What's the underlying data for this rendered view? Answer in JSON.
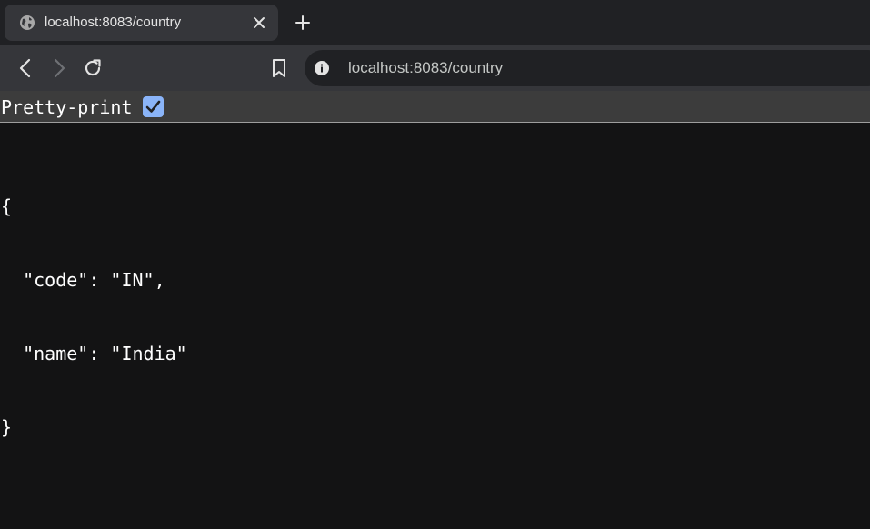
{
  "tab": {
    "title": "localhost:8083/country",
    "close_icon": "close-icon",
    "favicon": "globe-icon"
  },
  "new_tab_icon": "plus-icon",
  "toolbar": {
    "back_icon": "chevron-left-icon",
    "forward_icon": "chevron-right-icon",
    "reload_icon": "reload-icon",
    "bookmark_icon": "bookmark-icon",
    "site_info_icon": "info-icon",
    "url": "localhost:8083/country"
  },
  "pretty_print": {
    "label": "Pretty-print",
    "checked": true
  },
  "json": {
    "open_brace": "{",
    "line1": "  \"code\": \"IN\",",
    "line2": "  \"name\": \"India\"",
    "close_brace": "}"
  },
  "colors": {
    "page_bg": "#131314",
    "tabstrip_bg": "#202124",
    "toolbar_bg": "#35363a",
    "checkbox_accent": "#8ab4f8"
  }
}
